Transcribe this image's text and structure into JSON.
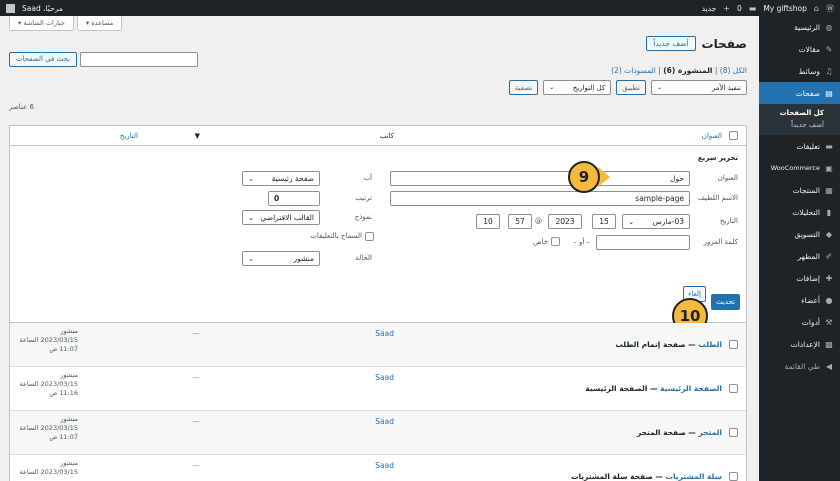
{
  "adminbar": {
    "site_name": "My giftshop",
    "new_label": "جديد",
    "comments_count": "0",
    "user_label": "مرحبًا، Saad"
  },
  "sidebar": {
    "items": [
      {
        "label": "الرئيسية",
        "icon": "dashboard-icon"
      },
      {
        "label": "مقالات",
        "icon": "pin-icon"
      },
      {
        "label": "وسائط",
        "icon": "media-icon"
      },
      {
        "label": "صفحات",
        "icon": "pages-icon"
      },
      {
        "label": "تعليقات",
        "icon": "comments-icon"
      },
      {
        "label": "WooCommerce",
        "icon": "woo-icon"
      },
      {
        "label": "المنتجات",
        "icon": "products-icon"
      },
      {
        "label": "التحليلات",
        "icon": "analytics-icon"
      },
      {
        "label": "التسويق",
        "icon": "marketing-icon"
      },
      {
        "label": "المظهر",
        "icon": "appearance-icon"
      },
      {
        "label": "إضافات",
        "icon": "plugins-icon"
      },
      {
        "label": "أعضاء",
        "icon": "users-icon"
      },
      {
        "label": "أدوات",
        "icon": "tools-icon"
      },
      {
        "label": "الإعدادات",
        "icon": "settings-icon"
      },
      {
        "label": "طي القائمة",
        "icon": "collapse-icon"
      }
    ],
    "sub": [
      "كل الصفحات",
      "أضف جديداً"
    ]
  },
  "screen": {
    "options": "خيارات الشاشة ▾",
    "help": "مساعدة ▾"
  },
  "header": {
    "title": "صفحات",
    "add_new": "أضف جديداً"
  },
  "views": {
    "all": "الكل (8)",
    "published": "المنشورة (6)",
    "drafts": "المسودات (2)"
  },
  "search": {
    "button": "بحث في الصفحات"
  },
  "bulk": {
    "action": "تنفيذ الأمر",
    "apply": "تطبيق",
    "dates": "كل التواريخ",
    "filter": "تصفية"
  },
  "count": "6 عناصر",
  "table": {
    "col_title": "العنوان",
    "col_author": "كاتب",
    "col_date": "التاريخ"
  },
  "quick_edit": {
    "heading": "تحرير سريع",
    "title_label": "العنوان",
    "title_value": "حول",
    "slug_label": "الاسم اللطيف",
    "slug_value": "sample-page",
    "date_label": "التاريخ",
    "month": "03-مارس",
    "day": "15",
    "year": "2023",
    "hour": "10",
    "minute": "57",
    "at": "@",
    "password_label": "كلمة المرور",
    "or": "– أو –",
    "private": "خاص",
    "parent_label": "أب",
    "parent_value": "صفحة رئيسية",
    "order_label": "ترتيب",
    "order_value": "0",
    "template_label": "نموذج",
    "template_value": "القالب الافتراضي",
    "allow_comments": "السماح بالتعليقات",
    "status_label": "الحالة",
    "status_value": "منشور",
    "update": "تحديث",
    "cancel": "إلغاء"
  },
  "callouts": {
    "a": "9",
    "b": "10"
  },
  "rows": [
    {
      "title": "الطلب",
      "suffix": "— صفحة إتمام الطلب",
      "author": "Saad",
      "comments": "—",
      "status": "منشور",
      "date": "2023/03/15 الساعة",
      "time": "11:07 ص"
    },
    {
      "title": "الصفحة الرئيسية",
      "suffix": "— الصفحة الرئيسية",
      "author": "Saad",
      "comments": "—",
      "status": "منشور",
      "date": "2023/03/15 الساعة",
      "time": "11:16 ص"
    },
    {
      "title": "المتجر",
      "suffix": "— صفحة المتجر",
      "author": "Saad",
      "comments": "—",
      "status": "منشور",
      "date": "2023/03/15 الساعة",
      "time": "11:07 ص"
    },
    {
      "title": "سلة المشتريات",
      "suffix": "— صفحة سلة المشتريات",
      "author": "Saad",
      "comments": "—",
      "status": "منشور",
      "date": "2023/03/15 الساعة",
      "time": ""
    }
  ]
}
